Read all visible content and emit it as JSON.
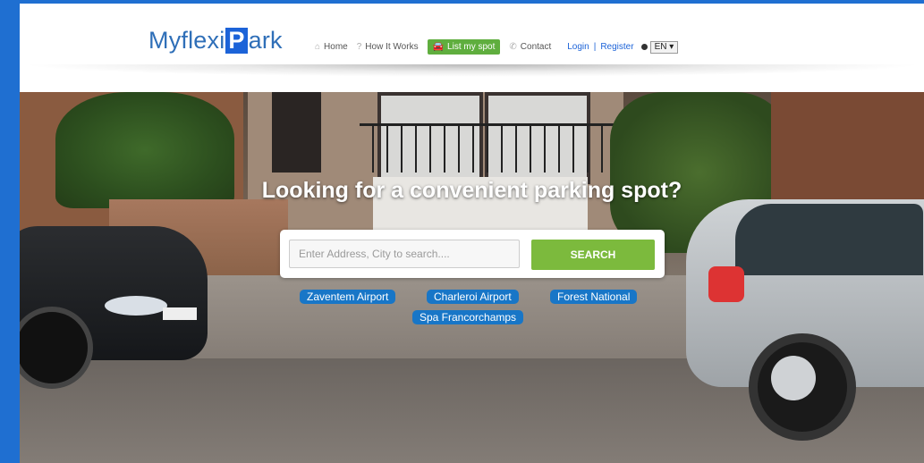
{
  "header": {
    "logo": {
      "part1": "Myflexi",
      "box": "P",
      "part2": "ark"
    },
    "nav": {
      "home": "Home",
      "how_it_works": "How It Works",
      "list_my_spot": "List my spot",
      "contact": "Contact",
      "login": "Login",
      "separator": "|",
      "register": "Register",
      "language": "EN ▾"
    }
  },
  "hero": {
    "headline": "Looking for a convenient parking spot?",
    "search": {
      "placeholder": "Enter Address, City to search....",
      "value": "",
      "button": "SEARCH"
    },
    "quick_links": [
      "Zaventem Airport",
      "Charleroi Airport",
      "Forest National",
      "Spa Francorchamps"
    ]
  },
  "colors": {
    "accent_blue": "#1c63d8",
    "green": "#7cba3d",
    "tag_blue": "#1876c7"
  },
  "icons": [
    "home-icon",
    "question-icon",
    "car-icon",
    "phone-icon",
    "globe-icon"
  ]
}
